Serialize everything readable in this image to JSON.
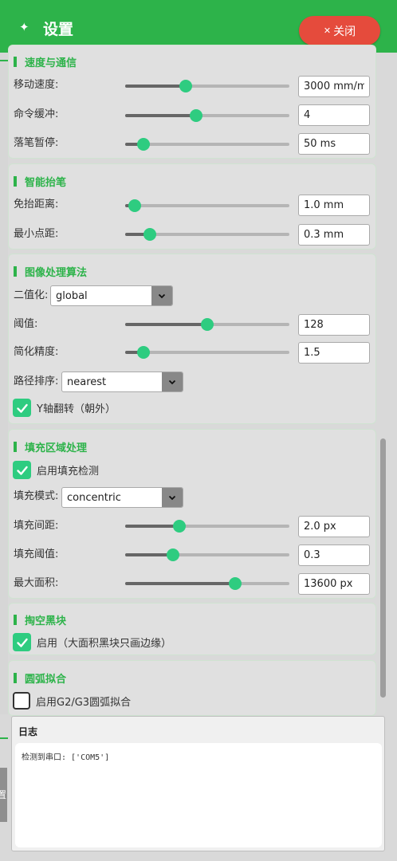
{
  "header": {
    "icon": "diamond-icon",
    "icon_glyph": "✦",
    "title": "设置",
    "close_label": "关闭",
    "close_glyph": "✕"
  },
  "sections": {
    "speed": {
      "title": "速度与通信",
      "move_speed": {
        "label": "移动速度:",
        "value": "3000 mm/min",
        "level": 0.37
      },
      "cmd_buffer": {
        "label": "命令缓冲:",
        "value": "4",
        "level": 0.43
      },
      "pen_pause": {
        "label": "落笔暂停:",
        "value": "50 ms",
        "level": 0.11
      }
    },
    "smart_lift": {
      "title": "智能抬笔",
      "no_lift_distance": {
        "label": "免抬距离:",
        "value": "1.0 mm",
        "level": 0.06
      },
      "min_point_distance": {
        "label": "最小点距:",
        "value": "0.3 mm",
        "level": 0.15
      }
    },
    "image_processing": {
      "title": "图像处理算法",
      "binarize": {
        "label": "二值化:",
        "value": "global"
      },
      "threshold": {
        "label": "阈值:",
        "value": "128",
        "level": 0.5
      },
      "simplify": {
        "label": "简化精度:",
        "value": "1.5",
        "level": 0.11
      },
      "path_order": {
        "label": "路径排序:",
        "value": "nearest"
      },
      "flip_y": {
        "label": "Y轴翻转（朝外）",
        "checked": true
      }
    },
    "fill": {
      "title": "填充区域处理",
      "enable_fill": {
        "label": "启用填充检测",
        "checked": true
      },
      "fill_mode": {
        "label": "填充模式:",
        "value": "concentric"
      },
      "fill_spacing": {
        "label": "填充间距:",
        "value": "2.0 px",
        "level": 0.33
      },
      "fill_threshold": {
        "label": "填充阈值:",
        "value": "0.3",
        "level": 0.29
      },
      "max_area": {
        "label": "最大面积:",
        "value": "13600 px",
        "level": 0.67
      }
    },
    "hollow": {
      "title": "掏空黑块",
      "enable": {
        "label": "启用（大面积黑块只画边缘）",
        "checked": true
      }
    },
    "arc": {
      "title": "圆弧拟合",
      "enable": {
        "label": "启用G2/G3圆弧拟合",
        "checked": false
      }
    }
  },
  "log": {
    "title": "日志",
    "lines": [
      "检测到串口: ['COM5']"
    ]
  },
  "side_tab": {
    "label": "置"
  },
  "colors": {
    "accent": "#2db34a",
    "slider_thumb": "#2ecc80",
    "close": "#e54b3c"
  }
}
